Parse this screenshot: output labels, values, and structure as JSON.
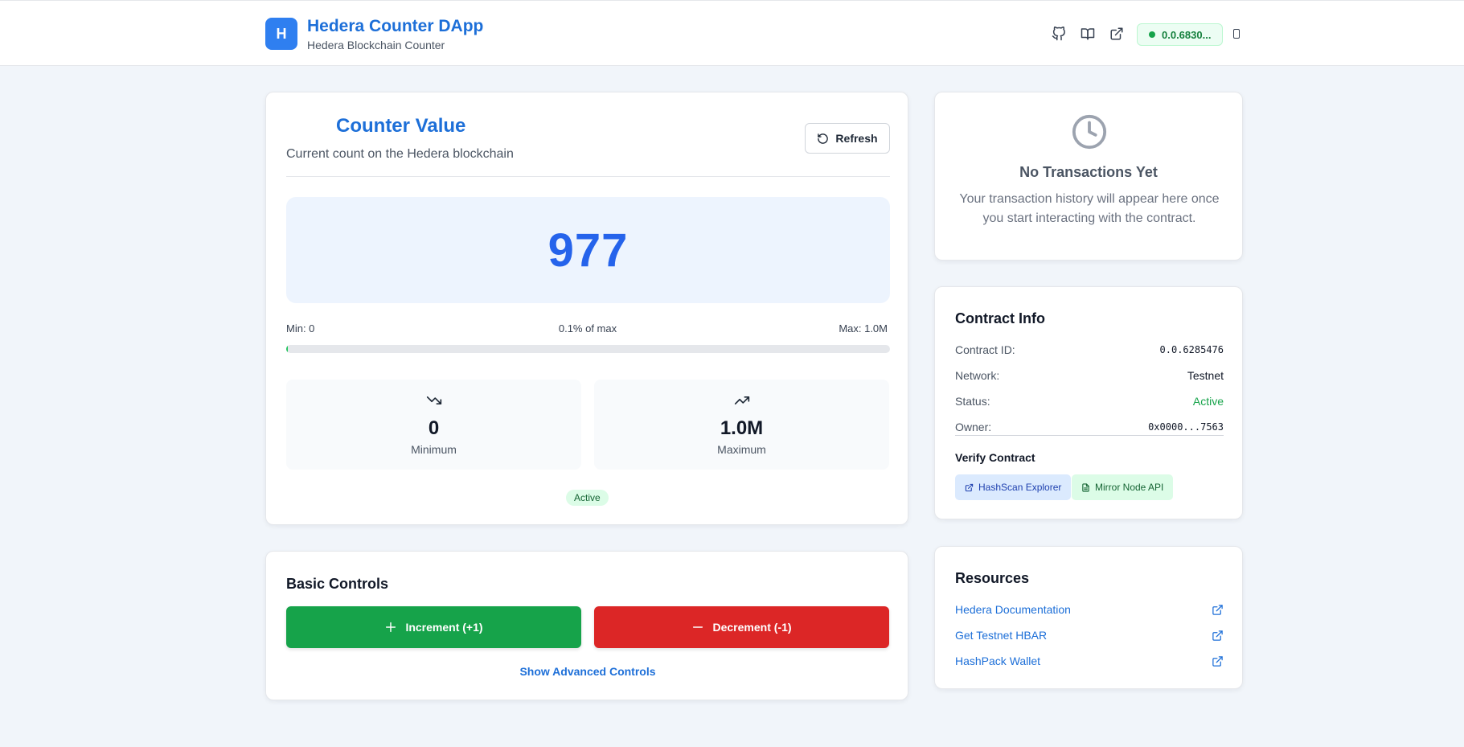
{
  "header": {
    "logo_letter": "H",
    "title": "Hedera Counter DApp",
    "subtitle": "Hedera Blockchain Counter",
    "icons": [
      "github-icon",
      "book-icon",
      "external-link-icon"
    ],
    "wallet_id": "0.0.6830..."
  },
  "counter": {
    "title": "Counter Value",
    "description": "Current count on the Hedera blockchain",
    "refresh_label": "Refresh",
    "value": "977",
    "min_label": "Min: 0",
    "percent_label": "0.1% of max",
    "max_label": "Max: 1.0M",
    "progress_fraction": 0.001,
    "minimum": {
      "value": "0",
      "label": "Minimum"
    },
    "maximum": {
      "value": "1.0M",
      "label": "Maximum"
    },
    "status": "Active"
  },
  "controls": {
    "title": "Basic Controls",
    "increment_label": "Increment (+1)",
    "decrement_label": "Decrement (-1)",
    "advanced_label": "Show Advanced Controls"
  },
  "transactions": {
    "title": "No Transactions Yet",
    "description": "Your transaction history will appear here once you start interacting with the contract."
  },
  "contract": {
    "title": "Contract Info",
    "rows": [
      {
        "label": "Contract ID:",
        "value": "0.0.6285476"
      },
      {
        "label": "Network:",
        "value": "Testnet"
      },
      {
        "label": "Status:",
        "value": "Active"
      },
      {
        "label": "Owner:",
        "value": "0x0000...7563"
      }
    ],
    "verify_title": "Verify Contract",
    "hashscan_label": "HashScan Explorer",
    "mirror_label": "Mirror Node API",
    "status_color": "#16a34a"
  },
  "resources": {
    "title": "Resources",
    "links": [
      {
        "label": "Hedera Documentation"
      },
      {
        "label": "Get Testnet HBAR"
      },
      {
        "label": "HashPack Wallet"
      }
    ]
  },
  "colors": {
    "brand_blue": "#1d6fd8",
    "increment_green": "#16a34a",
    "decrement_red": "#dc2626",
    "value_blue": "#2563eb"
  }
}
